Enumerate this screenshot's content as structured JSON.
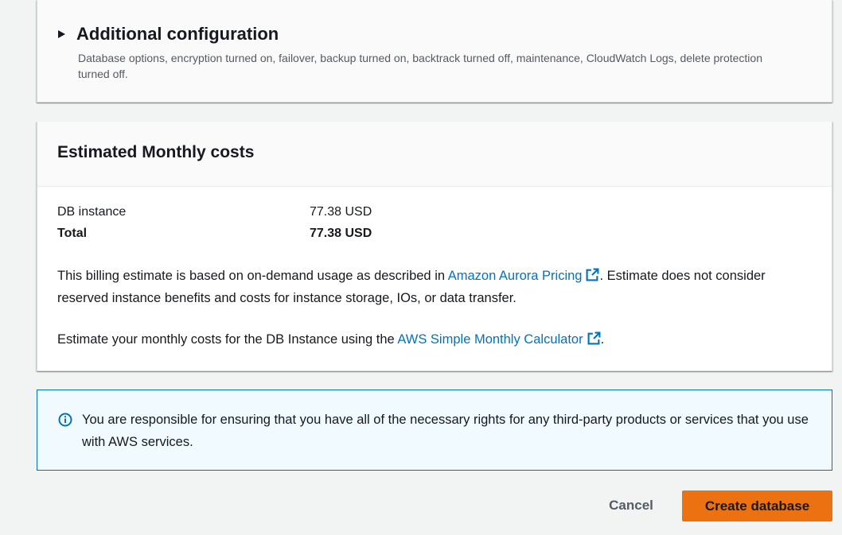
{
  "additional_config": {
    "title": "Additional configuration",
    "description": "Database options, encryption turned on, failover, backup turned on, backtrack turned off, maintenance, CloudWatch Logs, delete protection turned off."
  },
  "costs": {
    "title": "Estimated Monthly costs",
    "rows": [
      {
        "label": "DB instance",
        "value": "77.38 USD"
      },
      {
        "label": "Total",
        "value": "77.38 USD"
      }
    ],
    "para1": {
      "before": "This billing estimate is based on on-demand usage as described in ",
      "link": "Amazon Aurora Pricing",
      "after": ". Estimate does not consider reserved instance benefits and costs for instance storage, IOs, or data transfer."
    },
    "para2": {
      "before": "Estimate your monthly costs for the DB Instance using the ",
      "link": "AWS Simple Monthly Calculator",
      "after": "."
    }
  },
  "alert": {
    "text": "You are responsible for ensuring that you have all of the necessary rights for any third-party products or services that you use with AWS services."
  },
  "actions": {
    "cancel_label": "Cancel",
    "create_label": "Create database"
  },
  "colors": {
    "link": "#0073bb",
    "primary_button": "#ec7211",
    "info_border": "#0073bb",
    "info_background": "#f1faff"
  },
  "icons": {
    "expand": "caret-right-icon",
    "external_link": "external-link-icon",
    "info": "info-icon"
  }
}
